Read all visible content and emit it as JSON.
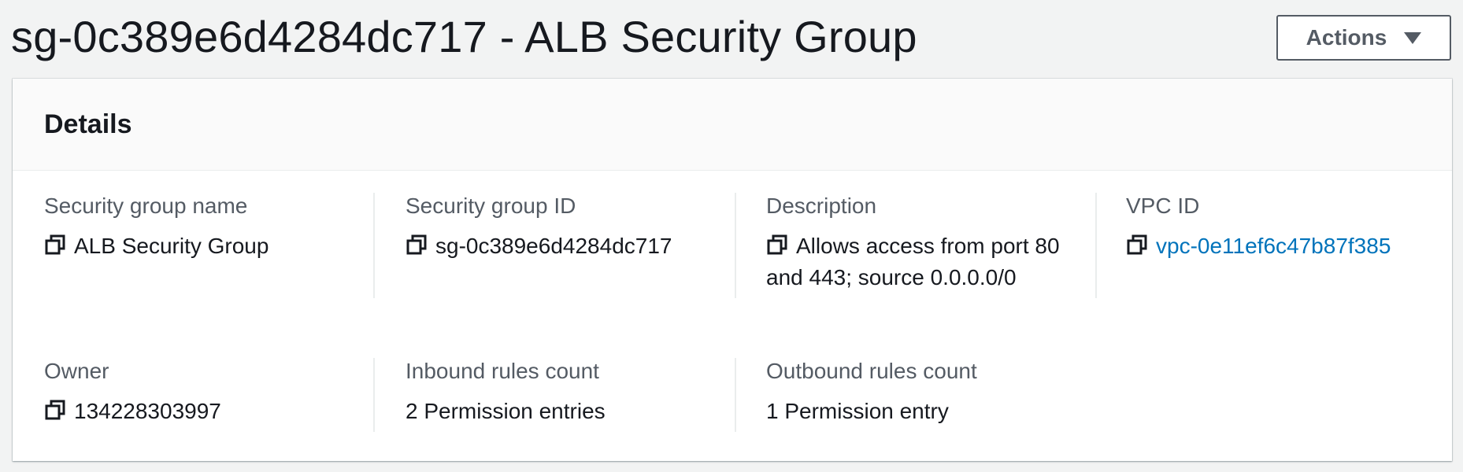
{
  "header": {
    "title": "sg-0c389e6d4284dc717 - ALB Security Group",
    "actions_label": "Actions",
    "actions_icon": "caret-down-icon"
  },
  "details": {
    "title": "Details",
    "fields": [
      {
        "label": "Security group name",
        "value": "ALB Security Group",
        "copy_icon": "copy-icon"
      },
      {
        "label": "Security group ID",
        "value": "sg-0c389e6d4284dc717",
        "copy_icon": "copy-icon"
      },
      {
        "label": "Description",
        "value": "Allows access from port 80 and 443; source 0.0.0.0/0",
        "copy_icon": "copy-icon"
      },
      {
        "label": "VPC ID",
        "value": "vpc-0e11ef6c47b87f385",
        "copy_icon": "copy-icon",
        "link": true
      },
      {
        "label": "Owner",
        "value": "134228303997",
        "copy_icon": "copy-icon"
      },
      {
        "label": "Inbound rules count",
        "value": "2 Permission entries"
      },
      {
        "label": "Outbound rules count",
        "value": "1 Permission entry"
      }
    ]
  },
  "colors": {
    "page_background": "#f2f3f3",
    "text": "#16191f",
    "label": "#545b64",
    "link": "#0073bb",
    "divider": "#eaeded"
  }
}
